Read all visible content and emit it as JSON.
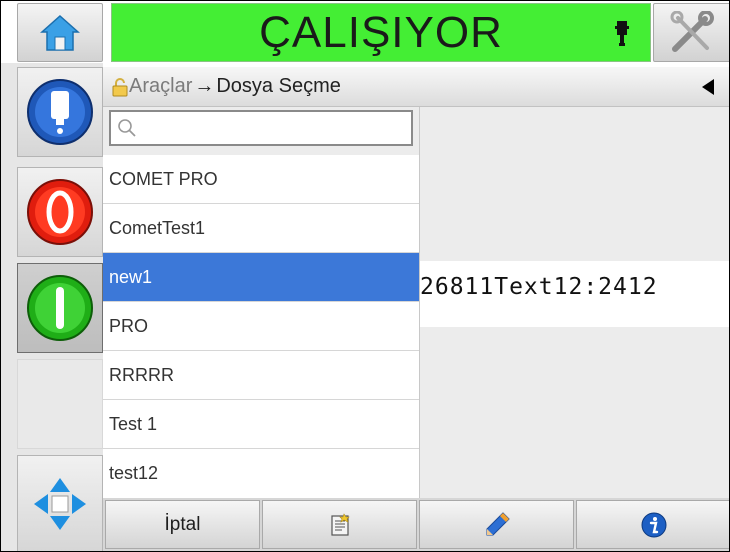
{
  "status": {
    "text": "ÇALIŞIYOR",
    "color": "#44ee34"
  },
  "top_bar": {
    "home_icon": "home-icon",
    "tools_icon": "tools-icon",
    "status_icon": "print-head-icon"
  },
  "breadcrumb": {
    "root": "Araçlar",
    "separator": "→",
    "current": "Dosya Seçme",
    "lock_icon": "lock-icon",
    "back_icon": "back-arrow-icon"
  },
  "side_buttons": [
    "ink-status-icon",
    "stop-icon",
    "start-icon",
    "navigation-arrows-icon"
  ],
  "search": {
    "value": "",
    "placeholder": ""
  },
  "files": [
    "COMET PRO",
    "CometTest1",
    "new1",
    "PRO",
    "RRRRR",
    "Test 1",
    "test12"
  ],
  "selected_file": "new1",
  "preview": {
    "text": "26811Text12:2412"
  },
  "toolbar": {
    "cancel_label": "İptal",
    "buttons": [
      "cancel-button",
      "new-file-icon",
      "edit-pencil-icon",
      "info-icon"
    ]
  }
}
